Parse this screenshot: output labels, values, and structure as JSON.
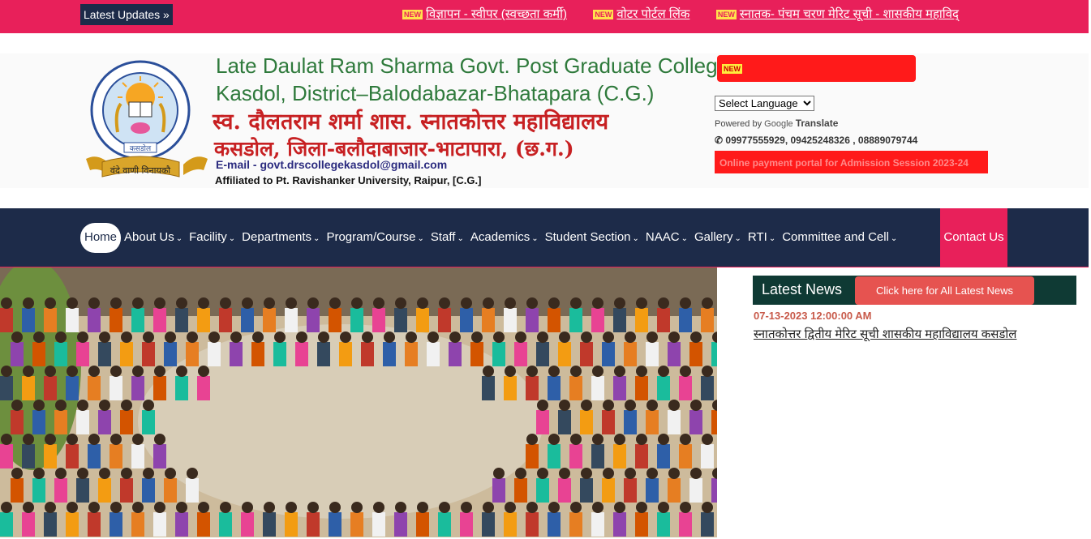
{
  "topbar": {
    "label": "Latest Updates »",
    "new_tag": "NEW",
    "items": [
      "विज्ञापन - स्वीपर (स्वच्छता कर्मी)",
      "वोटर पोर्टल लिंक",
      "स्नातक- पंचम चरण मेरिट सूची - शासकीय महाविद्"
    ]
  },
  "header": {
    "logo_top_text": "स्व. दौलतराम शर्मा शासकीय स्नातकोत्तर महाविद्यालय",
    "logo_town": "कसडोल",
    "logo_motto": "वंदे वाणी विनायकौ",
    "title_en_1": "Late Daulat Ram Sharma Govt. Post Graduate College",
    "title_en_2": "Kasdol, District–Balodabazar-Bhatapara (C.G.)",
    "title_hi_1": "स्व. दौलतराम शर्मा शास. स्नातकोत्तर महाविद्यालय",
    "title_hi_2": "कसडोल, जिला-बलौदाबाजार-भाटापारा, (छ.ग.)",
    "email": "E-mail - govt.drscollegekasdol@gmail.com",
    "affiliation": "Affiliated to Pt. Ravishanker University, Raipur, [C.G.]",
    "new_tag": "NEW",
    "language_select": "Select Language",
    "powered_by": "Powered by",
    "google": "Google",
    "translate": "Translate",
    "phones": "09977555929, 09425248326 , 08889079744",
    "payment_button": "Online payment portal for Admission Session 2023-24"
  },
  "nav": {
    "items": [
      {
        "label": "Home",
        "dropdown": false
      },
      {
        "label": "About Us",
        "dropdown": true
      },
      {
        "label": "Facility",
        "dropdown": true
      },
      {
        "label": "Departments",
        "dropdown": true
      },
      {
        "label": "Program/Course",
        "dropdown": true
      },
      {
        "label": "Staff",
        "dropdown": true
      },
      {
        "label": "Academics",
        "dropdown": true
      },
      {
        "label": "Student Section",
        "dropdown": true
      },
      {
        "label": "NAAC",
        "dropdown": true
      },
      {
        "label": "Gallery",
        "dropdown": true
      },
      {
        "label": "RTI",
        "dropdown": true
      },
      {
        "label": "Committee and Cell",
        "dropdown": true
      }
    ],
    "contact": "Contact Us"
  },
  "news": {
    "heading": "Latest News",
    "all_button": "Click here for All Latest News",
    "date": "07-13-2023 12:00:00 AM",
    "item": "स्नातकोत्तर द्वितीय मेरिट सूची शासकीय महाविद्यालय कसडोल"
  },
  "colors": {
    "accent_pink": "#e8205a",
    "navy": "#1d2b49",
    "green_title": "#2f7a3c",
    "red_title": "#c72022",
    "news_bar": "#0f3a34"
  }
}
